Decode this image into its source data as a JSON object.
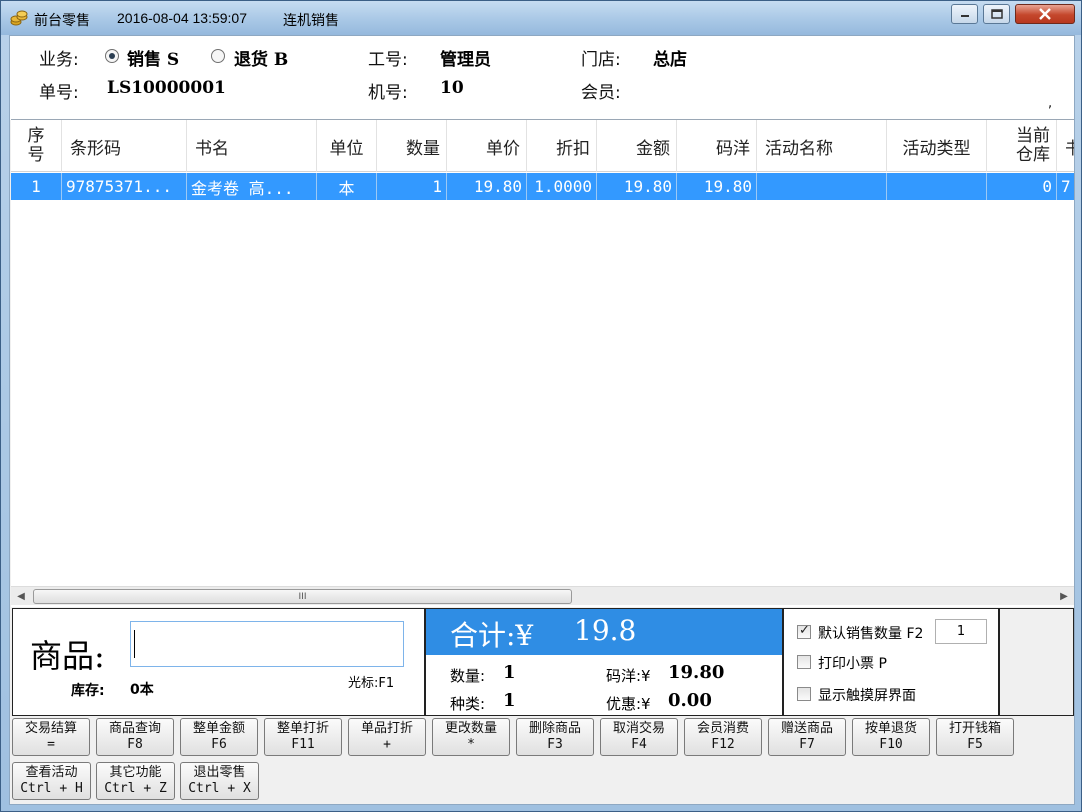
{
  "window": {
    "app_title": "前台零售",
    "datetime": "2016-08-04 13:59:07",
    "mode": "连机销售"
  },
  "header": {
    "business_label": "业务:",
    "sale_option": "销售 S",
    "return_option": "退货 B",
    "selected_option": "销售 S",
    "employee_label": "工号:",
    "employee_value": "管理员",
    "store_label": "门店:",
    "store_value": "总店",
    "order_label": "单号:",
    "order_value": "LS10000001",
    "machine_label": "机号:",
    "machine_value": "10",
    "member_label": "会员:",
    "member_value": "",
    "stray_mark": ","
  },
  "table": {
    "columns": [
      {
        "line1": "序",
        "line2": "号"
      },
      {
        "line1": "条形码"
      },
      {
        "line1": "书名"
      },
      {
        "line1": "单位"
      },
      {
        "line1": "数量"
      },
      {
        "line1": "单价"
      },
      {
        "line1": "折扣"
      },
      {
        "line1": "金额"
      },
      {
        "line1": "码洋"
      },
      {
        "line1": "活动名称"
      },
      {
        "line1": "活动类型"
      },
      {
        "line1": "当前",
        "line2": "仓库"
      },
      {
        "line1": "书"
      }
    ],
    "rows": [
      [
        "1",
        "97875371...",
        "金考卷 高...",
        "本",
        "1",
        "19.80",
        "1.0000",
        "19.80",
        "19.80",
        "",
        "",
        "0",
        "7"
      ]
    ],
    "scroll_grip": "III"
  },
  "goods_panel": {
    "label": "商品:",
    "input_value": "",
    "stock_label": "库存:",
    "stock_value": "0本",
    "cursor_hint": "光标:F1"
  },
  "total_panel": {
    "total_label": "合计:¥",
    "total_value": "19.8",
    "qty_label": "数量:",
    "qty_value": "1",
    "list_price_label": "码洋:¥",
    "list_price_value": "19.80",
    "kinds_label": "种类:",
    "kinds_value": "1",
    "discount_label": "优惠:¥",
    "discount_value": "0.00"
  },
  "options": {
    "default_qty_label": "默认销售数量 F2",
    "default_qty_checked": true,
    "default_qty_value": "1",
    "print_receipt_label": "打印小票 P",
    "print_receipt_checked": false,
    "touch_screen_label": "显示触摸屏界面",
    "touch_screen_checked": false
  },
  "buttons": [
    {
      "label": "交易结算",
      "key": "="
    },
    {
      "label": "商品查询",
      "key": "F8"
    },
    {
      "label": "整单金额",
      "key": "F6"
    },
    {
      "label": "整单打折",
      "key": "F11"
    },
    {
      "label": "单品打折",
      "key": "+"
    },
    {
      "label": "更改数量",
      "key": "*"
    },
    {
      "label": "删除商品",
      "key": "F3"
    },
    {
      "label": "取消交易",
      "key": "F4"
    },
    {
      "label": "会员消费",
      "key": "F12"
    },
    {
      "label": "赠送商品",
      "key": "F7"
    },
    {
      "label": "按单退货",
      "key": "F10"
    },
    {
      "label": "打开钱箱",
      "key": "F5"
    },
    {
      "label": "查看活动",
      "key": "Ctrl + H"
    },
    {
      "label": "其它功能",
      "key": "Ctrl + Z"
    },
    {
      "label": "退出零售",
      "key": "Ctrl + X"
    }
  ],
  "colors": {
    "selection": "#3399ff",
    "total_band": "#2f8de4",
    "title_bar": "#a9c8e6"
  }
}
